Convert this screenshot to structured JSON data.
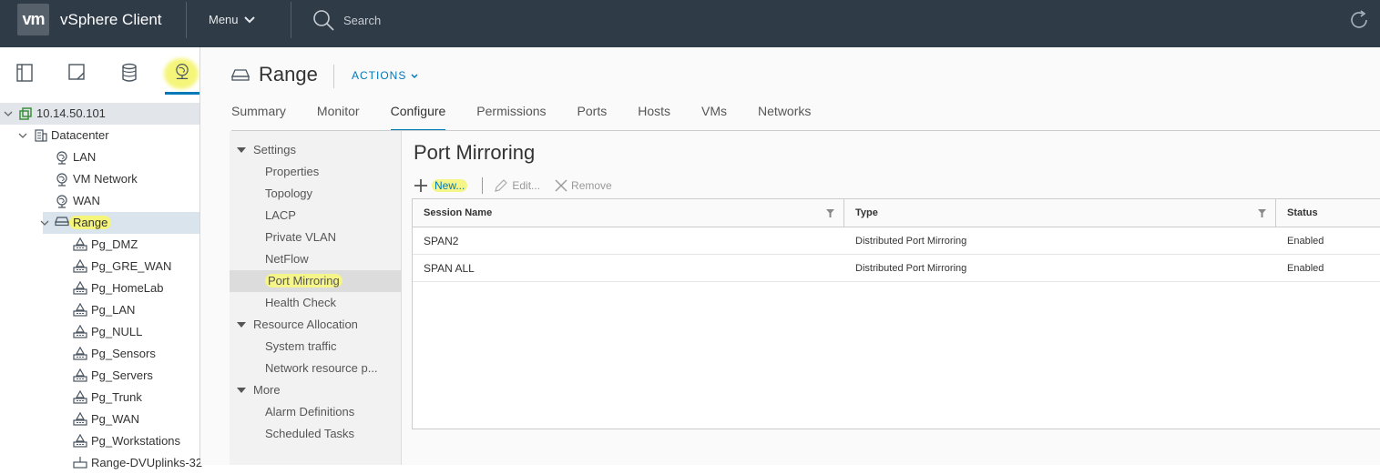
{
  "header": {
    "logo": "vm",
    "app_title": "vSphere Client",
    "menu_label": "Menu",
    "search_placeholder": "Search",
    "bg_color": "#2f3b47"
  },
  "left_nav": {
    "tabs": [
      "hosts-clusters-icon",
      "vms-templates-icon",
      "storage-icon",
      "networking-icon"
    ],
    "tree": [
      {
        "label": "10.14.50.101",
        "icon": "vcenter-icon",
        "level": 0,
        "expanded": true,
        "selected": true
      },
      {
        "label": "Datacenter",
        "icon": "datacenter-icon",
        "level": 1,
        "expanded": true
      },
      {
        "label": "LAN",
        "icon": "network-icon",
        "level": 2
      },
      {
        "label": "VM Network",
        "icon": "network-icon",
        "level": 2
      },
      {
        "label": "WAN",
        "icon": "network-icon",
        "level": 2
      },
      {
        "label": "Range",
        "icon": "switch-icon",
        "level": 2,
        "expanded": true,
        "highlighted": true
      },
      {
        "label": "Pg_DMZ",
        "icon": "portgroup-icon",
        "level": 3
      },
      {
        "label": "Pg_GRE_WAN",
        "icon": "portgroup-icon",
        "level": 3
      },
      {
        "label": "Pg_HomeLab",
        "icon": "portgroup-icon",
        "level": 3
      },
      {
        "label": "Pg_LAN",
        "icon": "portgroup-icon",
        "level": 3
      },
      {
        "label": "Pg_NULL",
        "icon": "portgroup-icon",
        "level": 3
      },
      {
        "label": "Pg_Sensors",
        "icon": "portgroup-icon",
        "level": 3
      },
      {
        "label": "Pg_Servers",
        "icon": "portgroup-icon",
        "level": 3
      },
      {
        "label": "Pg_Trunk",
        "icon": "portgroup-icon",
        "level": 3
      },
      {
        "label": "Pg_WAN",
        "icon": "portgroup-icon",
        "level": 3
      },
      {
        "label": "Pg_Workstations",
        "icon": "portgroup-icon",
        "level": 3
      },
      {
        "label": "Range-DVUplinks-32",
        "icon": "uplink-icon",
        "level": 3
      }
    ]
  },
  "object": {
    "title": "Range",
    "actions_label": "ACTIONS",
    "tabs": [
      "Summary",
      "Monitor",
      "Configure",
      "Permissions",
      "Ports",
      "Hosts",
      "VMs",
      "Networks"
    ],
    "active_tab": "Configure"
  },
  "settings_nav": [
    {
      "label": "Settings",
      "group": true
    },
    {
      "label": "Properties"
    },
    {
      "label": "Topology"
    },
    {
      "label": "LACP"
    },
    {
      "label": "Private VLAN"
    },
    {
      "label": "NetFlow"
    },
    {
      "label": "Port Mirroring",
      "selected": true
    },
    {
      "label": "Health Check"
    },
    {
      "label": "Resource Allocation",
      "group": true
    },
    {
      "label": "System traffic"
    },
    {
      "label": "Network resource p..."
    },
    {
      "label": "More",
      "group": true
    },
    {
      "label": "Alarm Definitions"
    },
    {
      "label": "Scheduled Tasks"
    }
  ],
  "content": {
    "title": "Port Mirroring",
    "toolbar": {
      "new_label": "New...",
      "edit_label": "Edit...",
      "remove_label": "Remove"
    },
    "grid": {
      "columns": [
        "Session Name",
        "Type",
        "Status"
      ],
      "rows": [
        [
          "SPAN2",
          "Distributed Port Mirroring",
          "Enabled"
        ],
        [
          "SPAN ALL",
          "Distributed Port Mirroring",
          "Enabled"
        ]
      ]
    }
  },
  "colors": {
    "accent": "#0079b8",
    "highlight": "#f5f57a"
  }
}
